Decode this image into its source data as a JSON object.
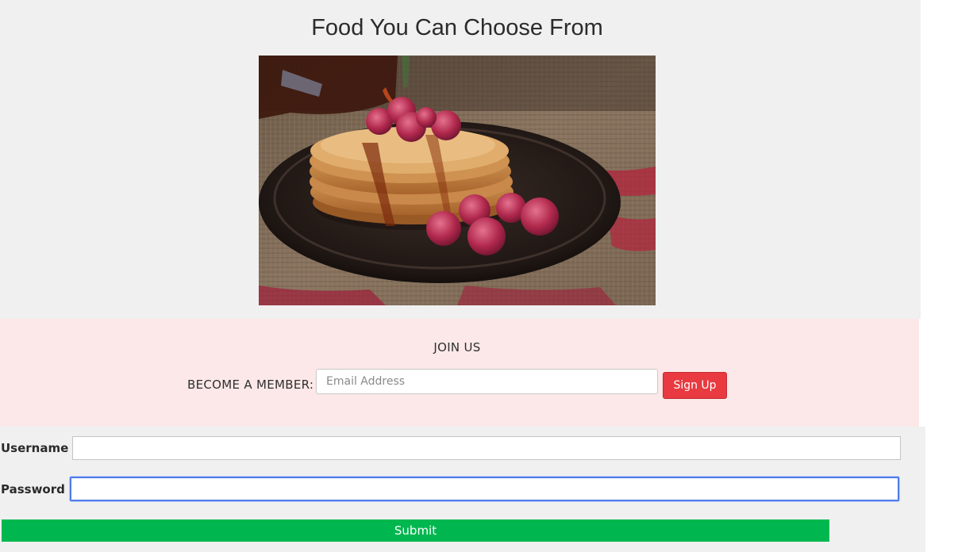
{
  "food": {
    "title": "Food You Can Choose From"
  },
  "join": {
    "heading": "JOIN US",
    "member_label": "BECOME A MEMBER:",
    "email_placeholder": "Email Address",
    "signup_label": "Sign Up"
  },
  "login": {
    "username_label": "Username",
    "password_label": "Password",
    "submit_label": "Submit"
  },
  "colors": {
    "signup_button": "#e83a40",
    "submit_button": "#00b74f",
    "join_background": "#fce8e8",
    "focus_ring": "#4f7be8"
  }
}
